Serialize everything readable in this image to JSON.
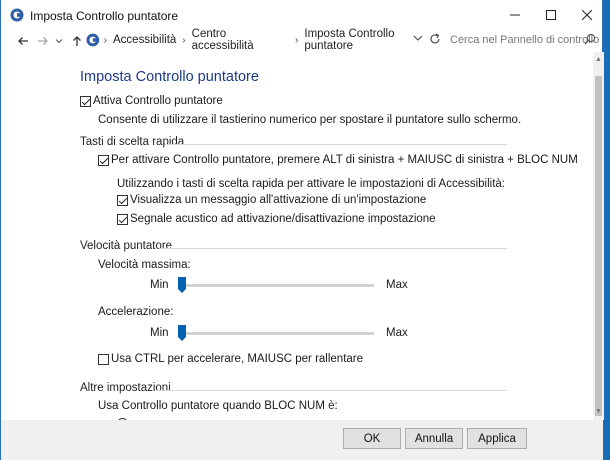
{
  "window": {
    "title": "Imposta Controllo puntatore"
  },
  "address": {
    "crumbs": [
      "Accessibilità",
      "Centro accessibilità",
      "Imposta Controllo puntatore"
    ],
    "search_placeholder": "Cerca nel Pannello di controllo"
  },
  "page": {
    "title": "Imposta Controllo puntatore",
    "enable": {
      "label": "Attiva Controllo puntatore",
      "checked": true
    },
    "enable_desc": "Consente di utilizzare il tastierino numerico per spostare il puntatore sullo schermo."
  },
  "hotkeys": {
    "title": "Tasti di scelta rapida",
    "activate": {
      "label": "Per attivare Controllo puntatore, premere ALT di sinistra + MAIUSC di sinistra + BLOC NUM",
      "checked": true
    },
    "sub_desc": "Utilizzando i tasti di scelta rapida per attivare le impostazioni di Accessibilità:",
    "show_msg": {
      "label": "Visualizza un messaggio all'attivazione di un'impostazione",
      "checked": true
    },
    "beep": {
      "label": "Segnale acustico ad attivazione/disattivazione impostazione",
      "checked": true
    }
  },
  "speed": {
    "title": "Velocità puntatore",
    "max_speed": {
      "label": "Velocità massima:",
      "min": "Min",
      "max": "Max",
      "value": 0
    },
    "acceleration": {
      "label": "Accelerazione:",
      "min": "Min",
      "max": "Max",
      "value": 0
    },
    "ctrl_shift": {
      "label": "Usa CTRL per accelerare, MAIUSC per rallentare",
      "checked": false
    }
  },
  "other": {
    "title": "Altre impostazioni",
    "numlock_desc": "Usa Controllo puntatore quando BLOC NUM è:"
  },
  "footer": {
    "ok": "OK",
    "cancel": "Annulla",
    "apply": "Applica"
  }
}
